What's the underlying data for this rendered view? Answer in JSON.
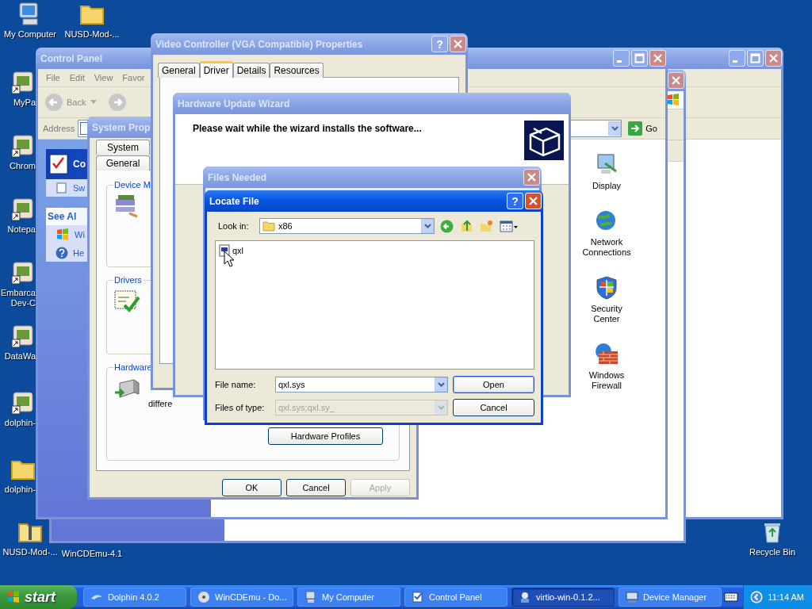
{
  "desktop_icons": [
    {
      "kind": "computer",
      "lines": [
        "My Computer"
      ]
    },
    {
      "kind": "folder",
      "lines": [
        "NUSD-Mod-..."
      ]
    },
    {
      "kind": "app",
      "lines": [
        "MyPa"
      ]
    },
    {
      "kind": "app",
      "lines": [
        "Chrom"
      ]
    },
    {
      "kind": "app",
      "lines": [
        "Notepa"
      ]
    },
    {
      "kind": "app",
      "lines": [
        "Embarca",
        "Dev-C"
      ]
    },
    {
      "kind": "app",
      "lines": [
        "DataWa"
      ]
    },
    {
      "kind": "app",
      "lines": [
        "dolphin-"
      ]
    },
    {
      "kind": "folder",
      "lines": [
        "dolphin-"
      ]
    },
    {
      "kind": "zip",
      "lines": [
        "NUSD-Mod-..."
      ]
    },
    {
      "lines": [
        "WinCDEmu-4.1"
      ]
    },
    {
      "kind": "recycle",
      "lines": [
        "Recycle Bin"
      ]
    }
  ],
  "background_windows": [
    {
      "active": false
    },
    {
      "active": false
    }
  ],
  "control_panel": {
    "title": "Control Panel",
    "active": false,
    "menu": [
      "File",
      "Edit",
      "View",
      "Favor"
    ],
    "back": "Back",
    "address_label": "Address",
    "go": "Go",
    "task_pane": [
      {
        "header": "Co",
        "items": [
          "Sw"
        ]
      },
      {
        "header": "See Al",
        "items": [
          "Wi",
          "He"
        ]
      }
    ],
    "items": [
      {
        "lines": [
          "Display"
        ]
      },
      {
        "lines": [
          "Network",
          "Connections"
        ]
      },
      {
        "lines": [
          "Security",
          "Center"
        ]
      },
      {
        "lines": [
          "Windows",
          "Firewall"
        ]
      }
    ]
  },
  "system_properties": {
    "title": "System Prop",
    "active": false,
    "tabs": [
      {
        "label": "System",
        "selected": false
      },
      {
        "label": "General",
        "selected": false
      }
    ],
    "groups": [
      {
        "title": "Device M"
      },
      {
        "title": "Drivers"
      },
      {
        "title": "Hardware",
        "text": "differe",
        "button": "Hardware Profiles"
      }
    ],
    "buttons": [
      {
        "label": "OK",
        "disabled": false
      },
      {
        "label": "Cancel",
        "disabled": false
      },
      {
        "label": "Apply",
        "disabled": true
      }
    ]
  },
  "video_controller": {
    "title": "Video Controller (VGA Compatible) Properties",
    "active": false,
    "help_button": "?",
    "tabs": [
      {
        "label": "General",
        "selected": false
      },
      {
        "label": "Driver",
        "selected": true
      },
      {
        "label": "Details",
        "selected": false
      },
      {
        "label": "Resources",
        "selected": false
      }
    ]
  },
  "wizard": {
    "title": "Hardware Update Wizard",
    "active": false,
    "heading": "Please wait while the wizard installs the software..."
  },
  "files_needed": {
    "title": "Files Needed",
    "active": false
  },
  "locate_file": {
    "title": "Locate File",
    "active": true,
    "help_button": "?",
    "look_in_label": "Look in:",
    "look_in": "x86",
    "files": [
      {
        "name": "qxl"
      }
    ],
    "file_name_label": "File name:",
    "file_name": "qxl.sys",
    "file_type_label": "Files of type:",
    "file_type": "qxl.sys;qxl.sy_",
    "file_type_disabled": true,
    "buttons": [
      {
        "label": "Open",
        "default": true
      },
      {
        "label": "Cancel",
        "default": false
      }
    ]
  },
  "taskbar": {
    "start": "start",
    "items": [
      {
        "label": "Dolphin 4.0.2",
        "selected": false
      },
      {
        "label": "WinCDEmu - Do...",
        "selected": false
      },
      {
        "label": "My Computer",
        "selected": false
      },
      {
        "label": "Control Panel",
        "selected": false
      },
      {
        "label": "virtio-win-0.1.2...",
        "selected": true
      },
      {
        "label": "Device Manager",
        "selected": false
      }
    ],
    "clock": "11:14 AM"
  }
}
